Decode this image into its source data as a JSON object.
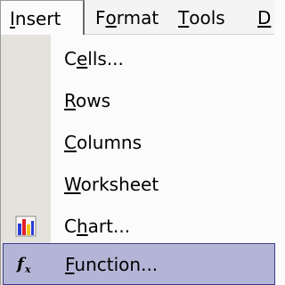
{
  "menubar": {
    "items": [
      {
        "first": "I",
        "rest": "nsert",
        "underline_index": 0
      },
      {
        "first": "F",
        "rest": "ormat",
        "prefix": "",
        "underline_char": "o"
      },
      {
        "first": "T",
        "rest": "ools"
      },
      {
        "first": "D",
        "rest": ""
      }
    ],
    "insert_label": "Insert",
    "format_label": "Format",
    "tools_label": "Tools",
    "partial_label": "D"
  },
  "menu": {
    "items": [
      {
        "label": "Cells...",
        "ul": "e",
        "icon": null
      },
      {
        "label": "Rows",
        "ul": "R",
        "icon": null
      },
      {
        "label": "Columns",
        "ul": "C",
        "icon": null
      },
      {
        "label": "Worksheet",
        "ul": "W",
        "icon": null
      },
      {
        "label": "Chart...",
        "ul": "h",
        "icon": "chart-icon"
      },
      {
        "label": "Function...",
        "ul": "F",
        "icon": "function-icon",
        "highlighted": true
      }
    ]
  },
  "colors": {
    "highlight_bg": "#b4b5d6",
    "highlight_border": "#3b3d8c",
    "gutter": "#e4e2dc"
  }
}
